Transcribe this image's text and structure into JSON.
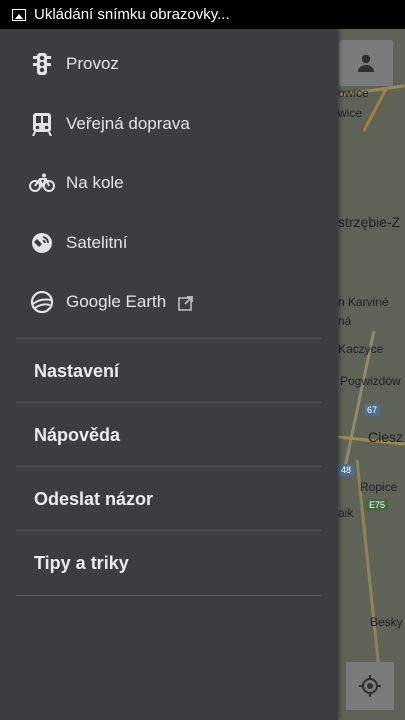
{
  "status_bar": {
    "text": "Ukládání snímku obrazovky...",
    "icon": "image-icon"
  },
  "drawer": {
    "layers": [
      {
        "label": "Provoz",
        "icon": "traffic-light-icon"
      },
      {
        "label": "Veřejná doprava",
        "icon": "transit-icon"
      },
      {
        "label": "Na kole",
        "icon": "bicycle-icon"
      },
      {
        "label": "Satelitní",
        "icon": "satellite-icon"
      },
      {
        "label": "Google Earth",
        "icon": "earth-icon",
        "external_icon": "external-link-icon"
      }
    ],
    "menu": [
      {
        "label": "Nastavení"
      },
      {
        "label": "Nápověda"
      },
      {
        "label": "Odeslat názor"
      },
      {
        "label": "Tipy a triky"
      }
    ]
  },
  "map": {
    "labels": [
      "owice",
      "wice",
      "strzębie-Z",
      "n Karviné",
      "ná",
      "Kaczyce",
      "Pogwizdów",
      "Ciesz",
      "Ropice",
      "aik",
      "Besky"
    ],
    "road_shields": [
      "67",
      "48",
      "E75"
    ]
  },
  "colors": {
    "drawer_bg": "#3b3d3e",
    "divider": "#555859",
    "text": "#e4e4e4"
  }
}
